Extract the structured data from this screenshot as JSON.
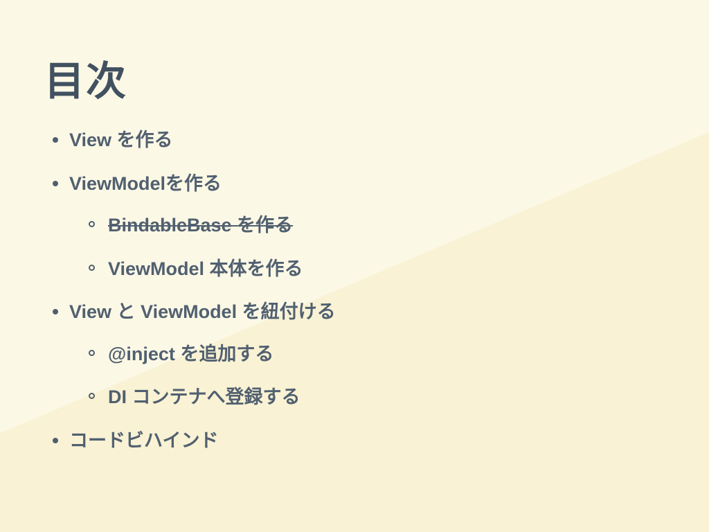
{
  "title": "目次",
  "items": [
    {
      "text": "View を作る",
      "strike": false
    },
    {
      "text": "ViewModelを作る",
      "strike": false,
      "children": [
        {
          "text": "BindableBase を作る",
          "strike": true
        },
        {
          "text": "ViewModel 本体を作る",
          "strike": false
        }
      ]
    },
    {
      "text": "View と ViewModel を紐付ける",
      "strike": false,
      "children": [
        {
          "text": "@inject を追加する",
          "strike": false
        },
        {
          "text": "DI コンテナへ登録する",
          "strike": false
        }
      ]
    },
    {
      "text": "コードビハインド",
      "strike": false
    }
  ]
}
